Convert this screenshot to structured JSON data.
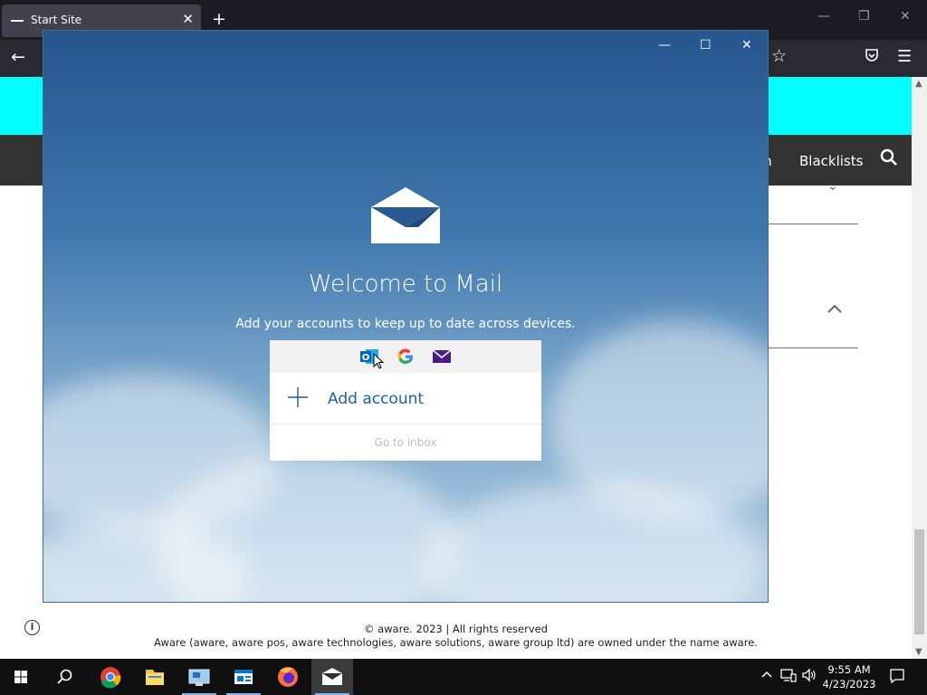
{
  "browser": {
    "tab_title": "Start Site",
    "close_glyph": "✕",
    "newtab_glyph": "+",
    "win_controls": [
      "—",
      "❐",
      "✕"
    ]
  },
  "site": {
    "nav_partial": "m",
    "nav_blacklists": "Blacklists",
    "footer_copyright": "© aware. 2023 | All rights reserved",
    "footer_owner": "Aware (aware, aware pos, aware technologies, aware solutions, aware group ltd) are owned under the name aware."
  },
  "mail": {
    "title": "Welcome to Mail",
    "subtitle": "Add your accounts to keep up to date across devices.",
    "add_account": "Add account",
    "go_to_inbox": "Go to inbox",
    "providers": [
      "outlook-icon",
      "google-icon",
      "mail-icon"
    ]
  },
  "taskbar": {
    "time": "9:55 AM",
    "date": "4/23/2023"
  },
  "colors": {
    "accent": "#1b5fa8",
    "cyan_banner": "#00ffff",
    "site_nav": "#333333"
  }
}
